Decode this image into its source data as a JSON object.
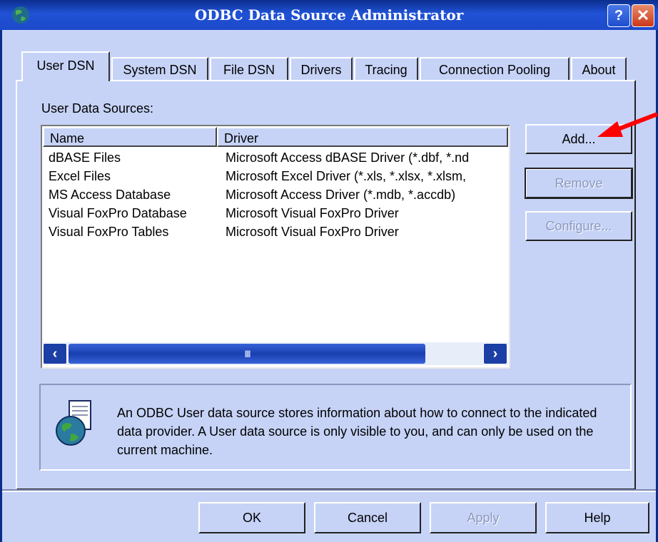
{
  "window": {
    "title": "ODBC Data Source Administrator",
    "help_label": "?",
    "close_label": "✕"
  },
  "tabs": [
    {
      "label": "User DSN",
      "active": true
    },
    {
      "label": "System DSN",
      "active": false
    },
    {
      "label": "File DSN",
      "active": false
    },
    {
      "label": "Drivers",
      "active": false
    },
    {
      "label": "Tracing",
      "active": false
    },
    {
      "label": "Connection Pooling",
      "active": false
    },
    {
      "label": "About",
      "active": false
    }
  ],
  "list": {
    "caption": "User Data Sources:",
    "columns": [
      "Name",
      "Driver"
    ],
    "rows": [
      {
        "name": "dBASE Files",
        "driver": "Microsoft Access dBASE Driver (*.dbf, *.nd"
      },
      {
        "name": "Excel Files",
        "driver": "Microsoft Excel Driver (*.xls, *.xlsx, *.xlsm,"
      },
      {
        "name": "MS Access Database",
        "driver": "Microsoft Access Driver (*.mdb, *.accdb)"
      },
      {
        "name": "Visual FoxPro Database",
        "driver": "Microsoft Visual FoxPro Driver"
      },
      {
        "name": "Visual FoxPro Tables",
        "driver": "Microsoft Visual FoxPro Driver"
      }
    ],
    "scroll_left": "‹",
    "scroll_right": "›",
    "scroll_grip": "IIII"
  },
  "side_buttons": {
    "add": "Add...",
    "remove": "Remove",
    "configure": "Configure..."
  },
  "info": {
    "text": "An ODBC User data source stores information about how to connect to the indicated data provider.   A User data source is only visible to you, and can only be used on the current machine."
  },
  "footer_buttons": {
    "ok": "OK",
    "cancel": "Cancel",
    "apply": "Apply",
    "help": "Help"
  },
  "colors": {
    "dialog_bg": "#c6d3f7",
    "titlebar": "#1b49c8",
    "annotation_arrow": "#ff0000"
  }
}
